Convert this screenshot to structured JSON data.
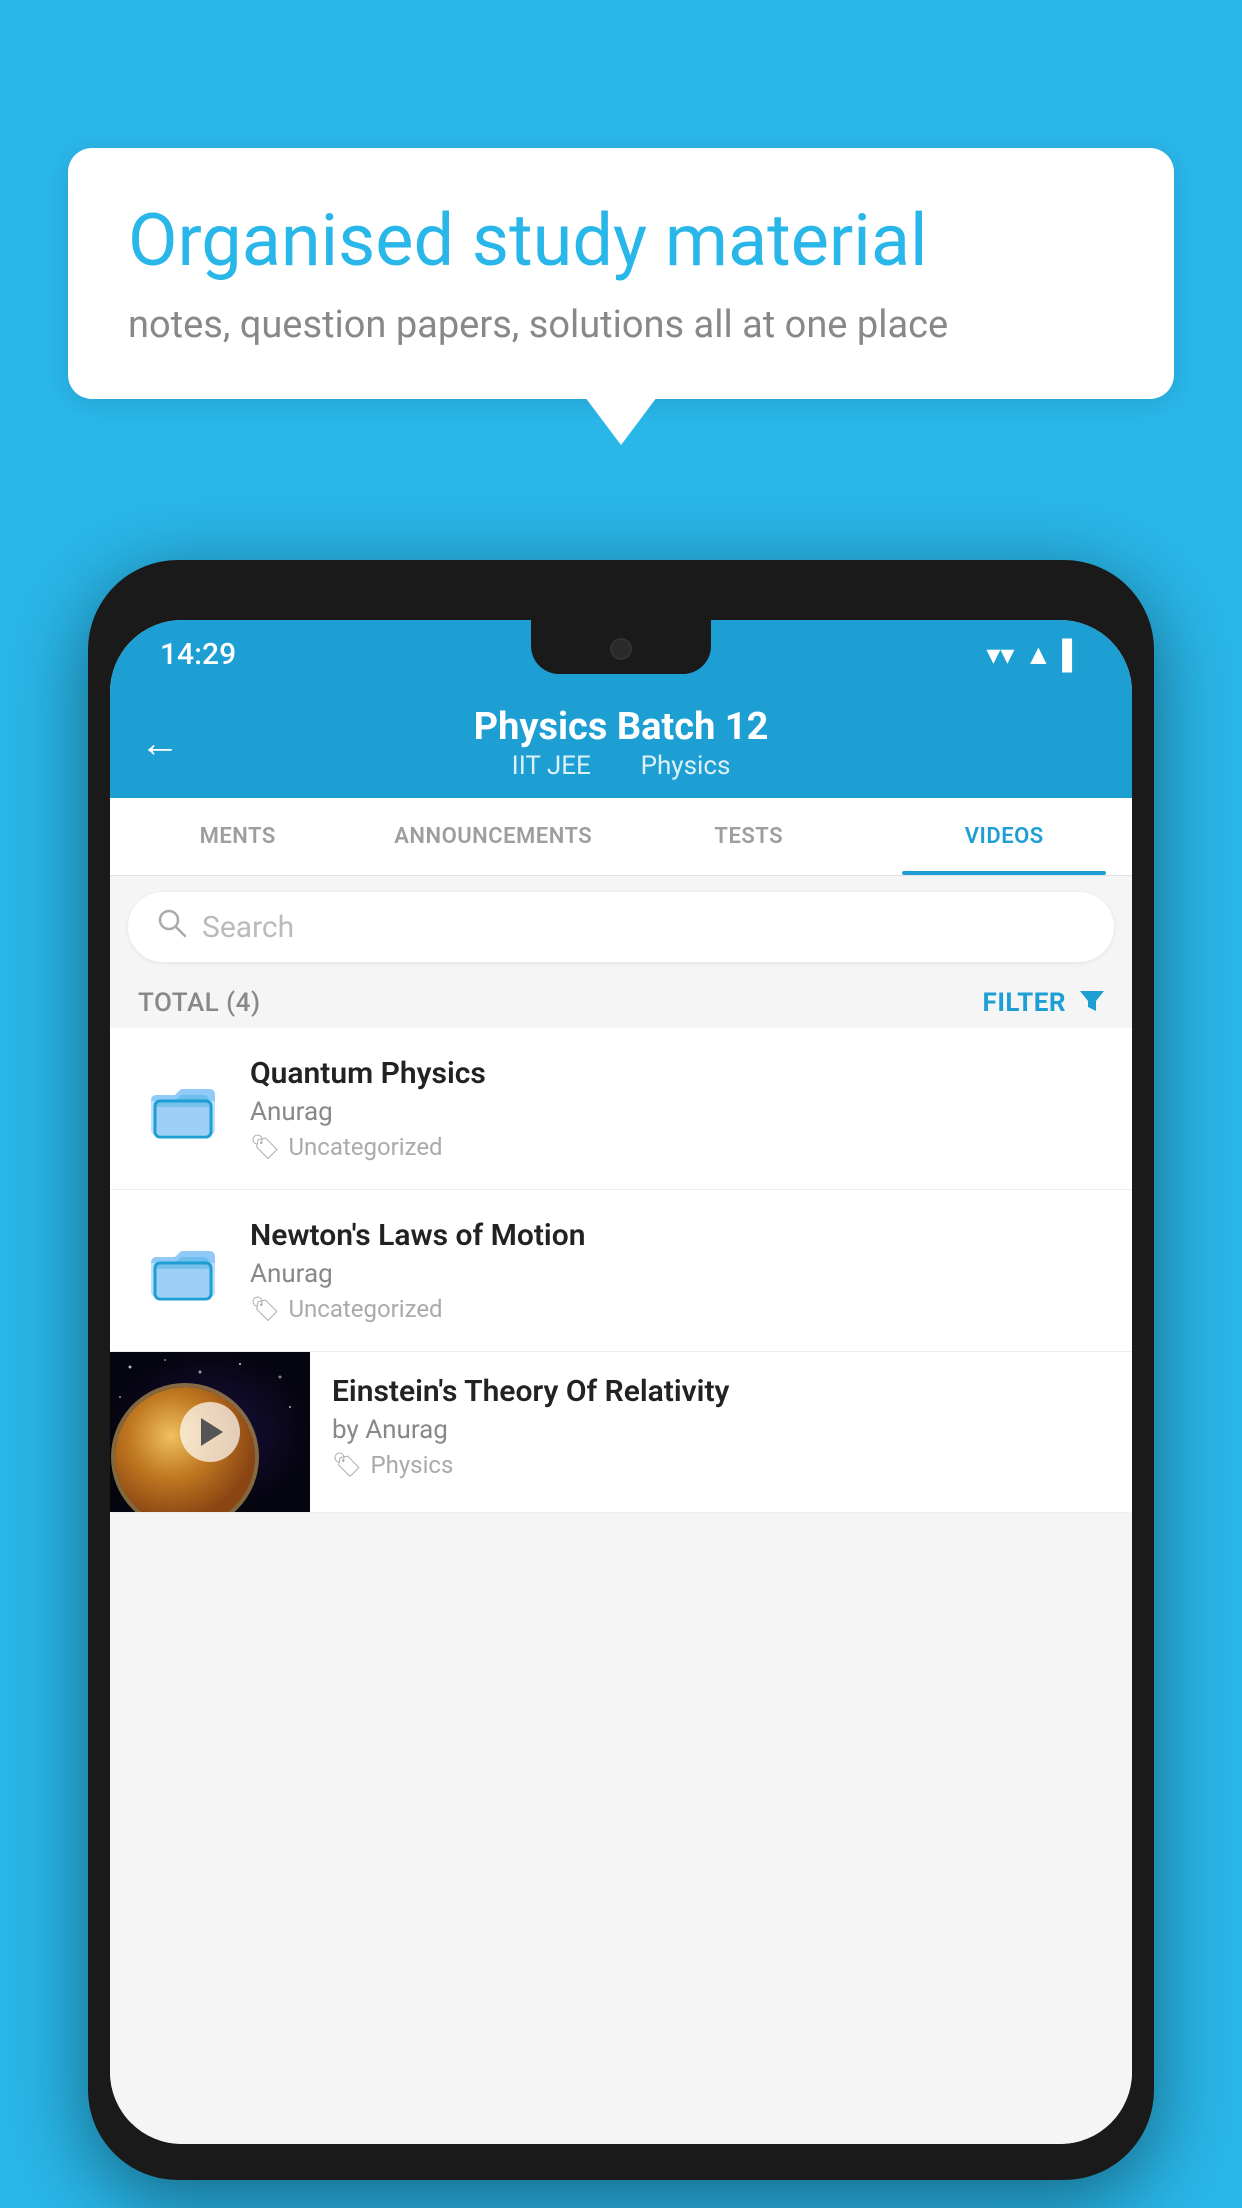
{
  "bubble": {
    "title": "Organised study material",
    "subtitle": "notes, question papers, solutions all at one place"
  },
  "status_bar": {
    "time": "14:29",
    "wifi": "▼",
    "signal": "▲",
    "battery": "▌"
  },
  "header": {
    "title": "Physics Batch 12",
    "tag1": "IIT JEE",
    "tag2": "Physics",
    "back_label": "←"
  },
  "tabs": [
    {
      "label": "MENTS",
      "active": false
    },
    {
      "label": "ANNOUNCEMENTS",
      "active": false
    },
    {
      "label": "TESTS",
      "active": false
    },
    {
      "label": "VIDEOS",
      "active": true
    }
  ],
  "search": {
    "placeholder": "Search"
  },
  "filter": {
    "total_label": "TOTAL (4)",
    "button_label": "FILTER"
  },
  "videos": [
    {
      "title": "Quantum Physics",
      "author": "Anurag",
      "tag": "Uncategorized",
      "type": "folder"
    },
    {
      "title": "Newton's Laws of Motion",
      "author": "Anurag",
      "tag": "Uncategorized",
      "type": "folder"
    },
    {
      "title": "Einstein's Theory Of Relativity",
      "author": "by Anurag",
      "tag": "Physics",
      "type": "video"
    }
  ]
}
